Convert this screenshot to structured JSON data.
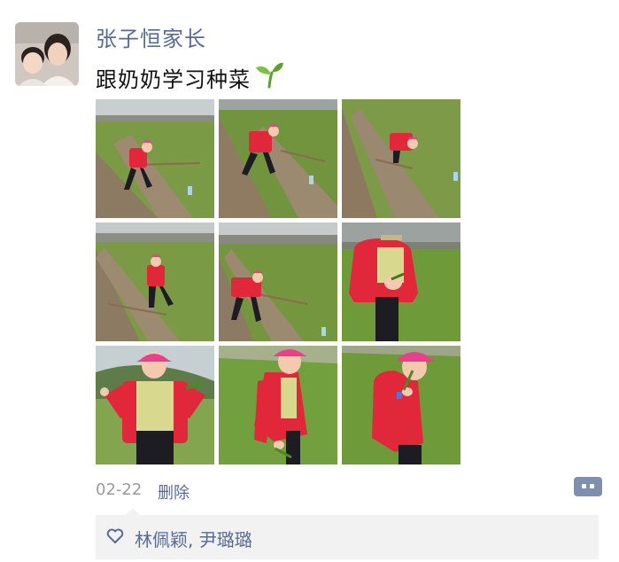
{
  "post": {
    "author": "张子恒家长",
    "text": "跟奶奶学习种菜",
    "text_icon": "sprout-icon",
    "time": "02-22",
    "delete_label": "删除",
    "likes": {
      "icon": "heart-outline-icon",
      "names": "林佩颖, 尹璐璐"
    },
    "photos": [
      {
        "name": "photo-1",
        "scene": "field"
      },
      {
        "name": "photo-2",
        "scene": "field"
      },
      {
        "name": "photo-3",
        "scene": "field"
      },
      {
        "name": "photo-4",
        "scene": "field"
      },
      {
        "name": "photo-5",
        "scene": "field"
      },
      {
        "name": "photo-6",
        "scene": "closeup"
      },
      {
        "name": "photo-7",
        "scene": "boy-hills"
      },
      {
        "name": "photo-8",
        "scene": "closeup"
      },
      {
        "name": "photo-9",
        "scene": "closeup"
      }
    ]
  },
  "colors": {
    "name_blue": "#586a96",
    "jacket_red": "#e0283a",
    "cap_pink": "#e8408a",
    "grass_green": "#6f9a3a"
  }
}
